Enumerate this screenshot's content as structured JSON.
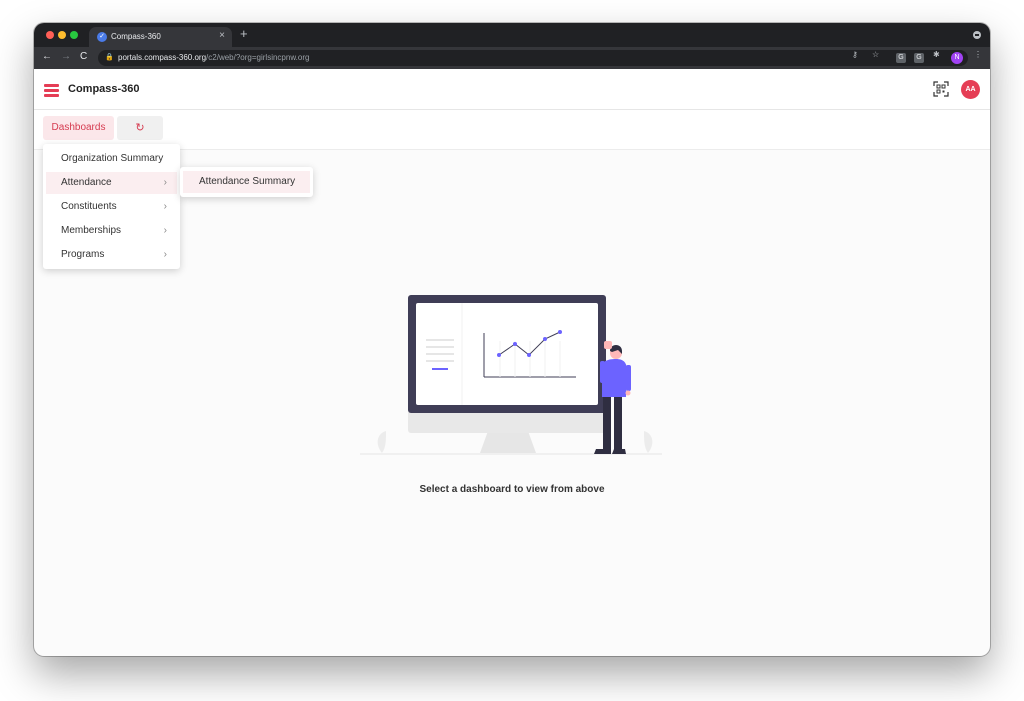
{
  "browser": {
    "tab_title": "Compass-360",
    "tab_close": "×",
    "new_tab": "+",
    "url_host": "portals.compass-360.org",
    "url_path": "/c2/web/?org=girlsincpnw.org",
    "extensions": [
      "G",
      "G"
    ],
    "profile_initial": "N"
  },
  "app": {
    "title": "Compass-360",
    "avatar_initials": "AA",
    "accent_color": "#e53d55"
  },
  "dashboard_bar": {
    "dashboards_label": "Dashboards",
    "refresh_icon": "↻"
  },
  "menu": {
    "items": [
      {
        "label": "Organization Summary",
        "has_submenu": false
      },
      {
        "label": "Attendance",
        "has_submenu": true,
        "active": true
      },
      {
        "label": "Constituents",
        "has_submenu": true
      },
      {
        "label": "Memberships",
        "has_submenu": true
      },
      {
        "label": "Programs",
        "has_submenu": true
      }
    ],
    "chevron": "›"
  },
  "submenu": {
    "items": [
      {
        "label": "Attendance Summary"
      }
    ]
  },
  "main": {
    "empty_message": "Select a dashboard to view from above"
  }
}
